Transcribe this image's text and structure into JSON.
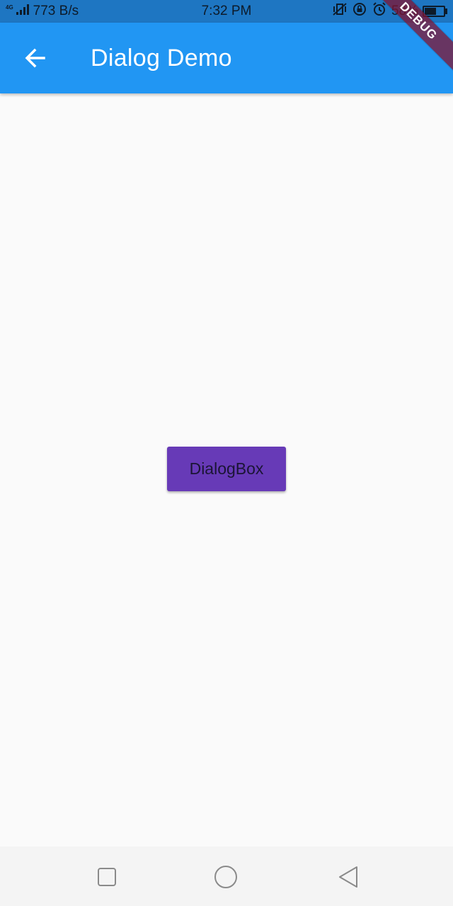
{
  "status_bar": {
    "network_type": "4G",
    "speed": "773 B/s",
    "time": "7:32 PM",
    "battery": "58%",
    "battery_level": 0.58,
    "icons": [
      "signal-icon",
      "vibrate-icon",
      "rotation-lock-icon",
      "alarm-icon",
      "battery-icon"
    ]
  },
  "app_bar": {
    "title": "Dialog Demo",
    "back_icon": "arrow-back-icon",
    "color": "#2196f3"
  },
  "debug_banner": {
    "label": "DEBUG"
  },
  "main": {
    "button_label": "DialogBox",
    "button_color": "#673ab7"
  },
  "nav_bar": {
    "items": [
      "recent-apps-icon",
      "home-icon",
      "back-triangle-icon"
    ]
  }
}
